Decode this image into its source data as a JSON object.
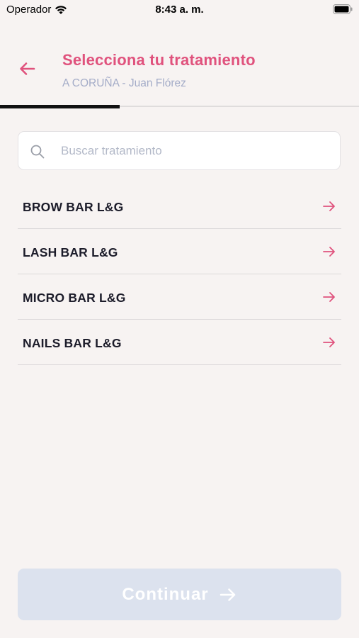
{
  "status_bar": {
    "carrier": "Operador",
    "time": "8:43 a. m."
  },
  "header": {
    "title": "Selecciona tu tratamiento",
    "subtitle": "A CORUÑA - Juan Flórez"
  },
  "progress": {
    "fraction": 0.333
  },
  "search": {
    "placeholder": "Buscar tratamiento",
    "value": ""
  },
  "treatments": [
    {
      "label": "BROW BAR L&G"
    },
    {
      "label": "LASH BAR L&G"
    },
    {
      "label": "MICRO BAR L&G"
    },
    {
      "label": "NAILS BAR L&G"
    }
  ],
  "footer": {
    "continue_label": "Continuar"
  },
  "colors": {
    "accent": "#e0527d",
    "subtitle": "#a4acc8",
    "background": "#f7f3f2",
    "button_disabled": "#dce2ee"
  },
  "icons": {
    "back": "arrow-left-icon",
    "search": "search-icon",
    "row_arrow": "arrow-right-icon",
    "wifi": "wifi-icon",
    "battery": "battery-icon"
  }
}
